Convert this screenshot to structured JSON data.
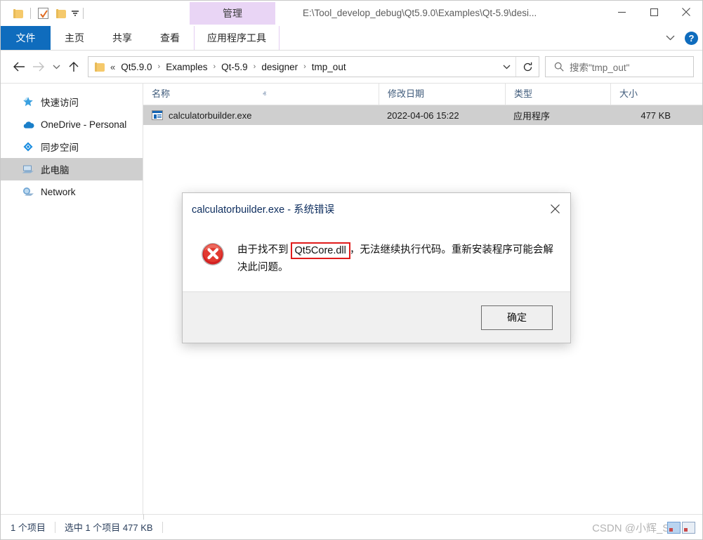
{
  "window": {
    "title": "E:\\Tool_develop_debug\\Qt5.9.0\\Examples\\Qt-5.9\\desi...",
    "minimize_label": "—",
    "maximize_label": "□",
    "close_label": "✕"
  },
  "quick_access_toolbar": {
    "items": [
      {
        "name": "folder-icon",
        "label": ""
      },
      {
        "name": "properties-icon",
        "label": ""
      },
      {
        "name": "new-folder-icon",
        "label": ""
      },
      {
        "name": "customize-dropdown-icon",
        "label": "▾"
      }
    ]
  },
  "ribbon": {
    "contextual_tab": "管理",
    "tabs": [
      {
        "label": "文件",
        "active": true
      },
      {
        "label": "主页",
        "active": false
      },
      {
        "label": "共享",
        "active": false
      },
      {
        "label": "查看",
        "active": false
      },
      {
        "label": "应用程序工具",
        "active": false
      }
    ],
    "collapse_label": "∨",
    "help_label": "?"
  },
  "address_bar": {
    "back_label": "←",
    "forward_label": "→",
    "recent_label": "∨",
    "up_label": "↑",
    "overflow_label": "«",
    "breadcrumbs": [
      "Qt5.9.0",
      "Examples",
      "Qt-5.9",
      "designer",
      "tmp_out"
    ],
    "separator": "›",
    "dropdown_label": "∨",
    "refresh_label": "↻"
  },
  "search": {
    "placeholder": "搜索\"tmp_out\"",
    "icon": "search-icon"
  },
  "sidebar": {
    "items": [
      {
        "label": "快速访问",
        "icon": "star-icon",
        "selected": false
      },
      {
        "label": "OneDrive - Personal",
        "icon": "cloud-icon",
        "selected": false
      },
      {
        "label": "同步空间",
        "icon": "sync-icon",
        "selected": false
      },
      {
        "label": "此电脑",
        "icon": "this-pc-icon",
        "selected": true
      },
      {
        "label": "Network",
        "icon": "network-icon",
        "selected": false
      }
    ]
  },
  "file_list": {
    "columns": [
      {
        "label": "名称",
        "sorted": true,
        "sort_arrow": "ⱏ"
      },
      {
        "label": "修改日期",
        "sorted": false
      },
      {
        "label": "类型",
        "sorted": false
      },
      {
        "label": "大小",
        "sorted": false
      }
    ],
    "rows": [
      {
        "name": "calculatorbuilder.exe",
        "date": "2022-04-06 15:22",
        "type": "应用程序",
        "size": "477 KB",
        "icon": "executable-icon",
        "selected": true
      }
    ]
  },
  "status_bar": {
    "item_count": "1 个项目",
    "selection": "选中 1 个项目  477 KB"
  },
  "watermark": {
    "text": "CSDN @小辉_Sun"
  },
  "dialog": {
    "title": "calculatorbuilder.exe - 系统错误",
    "close_label": "✕",
    "icon": "error-icon",
    "message_prefix": "由于找不到 ",
    "highlighted_dll": "Qt5Core.dll",
    "message_suffix": "，无法继续执行代码。重新安装程序可能会解决此问题。",
    "ok_label": "确定",
    "highlight_color": "#e01b1b"
  }
}
